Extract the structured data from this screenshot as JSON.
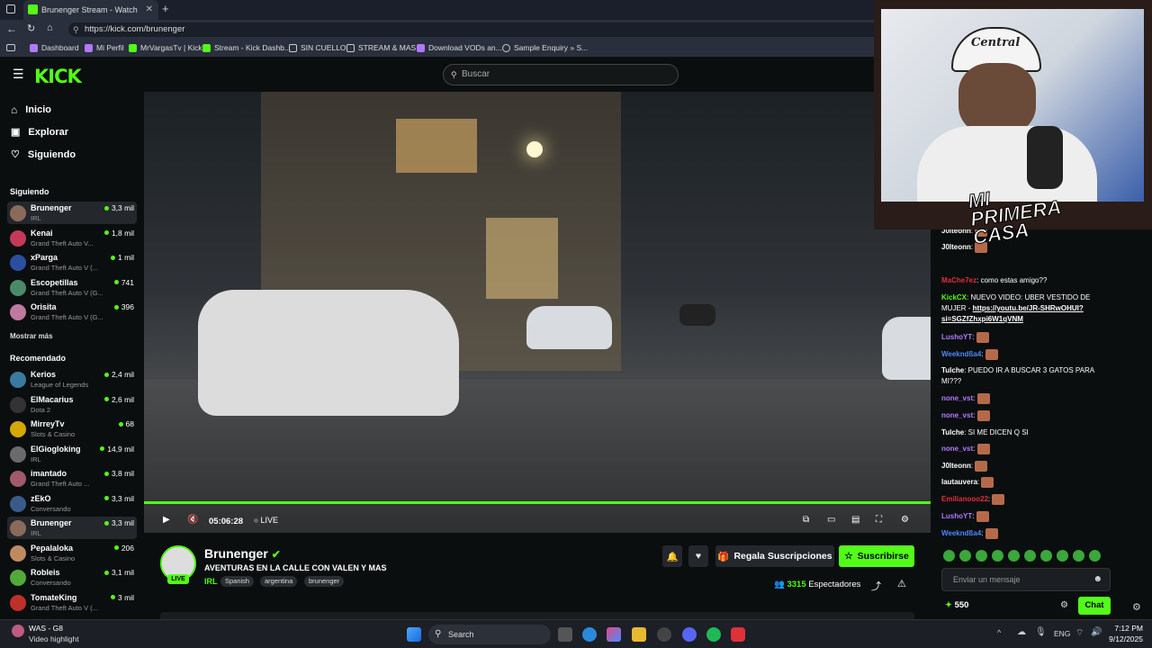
{
  "browser": {
    "tab_title": "Brunenger Stream - Watch Live o",
    "url": "https://kick.com/brunenger",
    "bookmarks": [
      "Dashboard",
      "Mi Perfil",
      "MrVargasTv | Kick",
      "Stream - Kick Dashb...",
      "SIN CUELLO",
      "STREAM & MAS",
      "Download VODs an...",
      "Sample Enquiry » S..."
    ]
  },
  "header": {
    "logo": "KICK",
    "search_placeholder": "Buscar"
  },
  "nav": {
    "home": "Inicio",
    "explore": "Explorar",
    "following": "Siguiendo"
  },
  "sidebar": {
    "following_title": "Siguiendo",
    "following": [
      {
        "name": "Brunenger",
        "category": "IRL",
        "viewers": "3,3 mil",
        "color": "#8a6a5a",
        "active": true
      },
      {
        "name": "Kenai",
        "category": "Grand Theft Auto V...",
        "viewers": "1,8 mil",
        "color": "#c23a58"
      },
      {
        "name": "xParga",
        "category": "Grand Theft Auto V (...",
        "viewers": "1 mil",
        "color": "#2a4fa0"
      },
      {
        "name": "Escopetillas",
        "category": "Grand Theft Auto V (G...",
        "viewers": "741",
        "color": "#4a8a6a"
      },
      {
        "name": "Orisita",
        "category": "Grand Theft Auto V (G...",
        "viewers": "396",
        "color": "#c07aa0"
      }
    ],
    "show_more": "Mostrar más",
    "recommended_title": "Recomendado",
    "recommended": [
      {
        "name": "Kerios",
        "category": "League of Legends",
        "viewers": "2,4 mil",
        "color": "#3a7aa0"
      },
      {
        "name": "ElMacarius",
        "category": "Dota 2",
        "viewers": "2,6 mil",
        "color": "#333333"
      },
      {
        "name": "MirreyTv",
        "category": "Slots & Casino",
        "viewers": "68",
        "color": "#d4a800"
      },
      {
        "name": "ElGiogloking",
        "category": "IRL",
        "viewers": "14,9 mil",
        "color": "#6a6a6a"
      },
      {
        "name": "imantado",
        "category": "Grand Theft Auto ...",
        "viewers": "3,8 mil",
        "color": "#a05a6a"
      },
      {
        "name": "zEkO",
        "category": "Conversando",
        "viewers": "3,3 mil",
        "color": "#3a5a8a"
      },
      {
        "name": "Brunenger",
        "category": "IRL",
        "viewers": "3,3 mil",
        "color": "#8a6a5a",
        "active": true
      },
      {
        "name": "Pepalaloka",
        "category": "Slots & Casino",
        "viewers": "206",
        "color": "#c08a60"
      },
      {
        "name": "Robleis",
        "category": "Conversando",
        "viewers": "3,1 mil",
        "color": "#53a83a"
      },
      {
        "name": "TomateKing",
        "category": "Grand Theft Auto V (...",
        "viewers": "3 mil",
        "color": "#c0302a"
      }
    ]
  },
  "player": {
    "time": "05:06:28",
    "live": "LIVE"
  },
  "stream": {
    "name": "Brunenger",
    "title": "AVENTURAS EN LA CALLE CON VALEN Y MAS",
    "category": "IRL",
    "tags": [
      "Spanish",
      "argentina",
      "brunenger"
    ],
    "live_badge": "LIVE",
    "gift_button": "Regala Suscripciones",
    "subscribe_button": "Suscribirse",
    "viewers": "3315",
    "viewers_label": "Espectadores"
  },
  "chat": {
    "messages": [
      {
        "user": "J0lteonn",
        "text": "",
        "color": "#ffffff"
      },
      {
        "user": "J0lteonn",
        "text": "",
        "color": "#ffffff"
      },
      {
        "user": "MaChe7ez",
        "text": "como estas amigo??",
        "color": "#e0303a"
      },
      {
        "user": "KickCX",
        "text": "NUEVO VIDEO: UBER VESTIDO DE MUJER - ",
        "link": "https://youtu.be/JR-SHRwOHUI?si=SGZfZhxpi6W1qVNM",
        "color": "#53fc18"
      },
      {
        "user": "LushoYT",
        "text": "",
        "color": "#b07aff"
      },
      {
        "user": "Weekndßa4",
        "text": "",
        "color": "#4a8aff"
      },
      {
        "user": "Tulche",
        "text": "PUEDO IR A BUSCAR 3 GATOS PARA MI???",
        "color": "#ffffff"
      },
      {
        "user": "none_vst",
        "text": "",
        "color": "#b07aff"
      },
      {
        "user": "none_vst",
        "text": "",
        "color": "#b07aff"
      },
      {
        "user": "Tulche",
        "text": "SI ME DICEN Q SI",
        "color": "#ffffff"
      },
      {
        "user": "none_vst",
        "text": "",
        "color": "#b07aff"
      },
      {
        "user": "J0lteonn",
        "text": "",
        "color": "#ffffff"
      },
      {
        "user": "lautauvera",
        "text": "",
        "color": "#ffffff"
      },
      {
        "user": "Emilianooo22",
        "text": "",
        "color": "#e0303a"
      },
      {
        "user": "LushoYT",
        "text": "",
        "color": "#b07aff"
      },
      {
        "user": "Weekndßa4",
        "text": "",
        "color": "#4a8aff"
      }
    ],
    "input_placeholder": "Enviar un mensaje",
    "points": "550",
    "send_button": "Chat"
  },
  "overlay": {
    "cap_text": "Central",
    "banner": "MI PRIMERA CASA"
  },
  "taskbar": {
    "notification_title": "WAS - G8",
    "notification_sub": "Video highlight",
    "search": "Search",
    "lang": "ENG",
    "time": "7:12 PM",
    "date": "9/12/2025"
  }
}
